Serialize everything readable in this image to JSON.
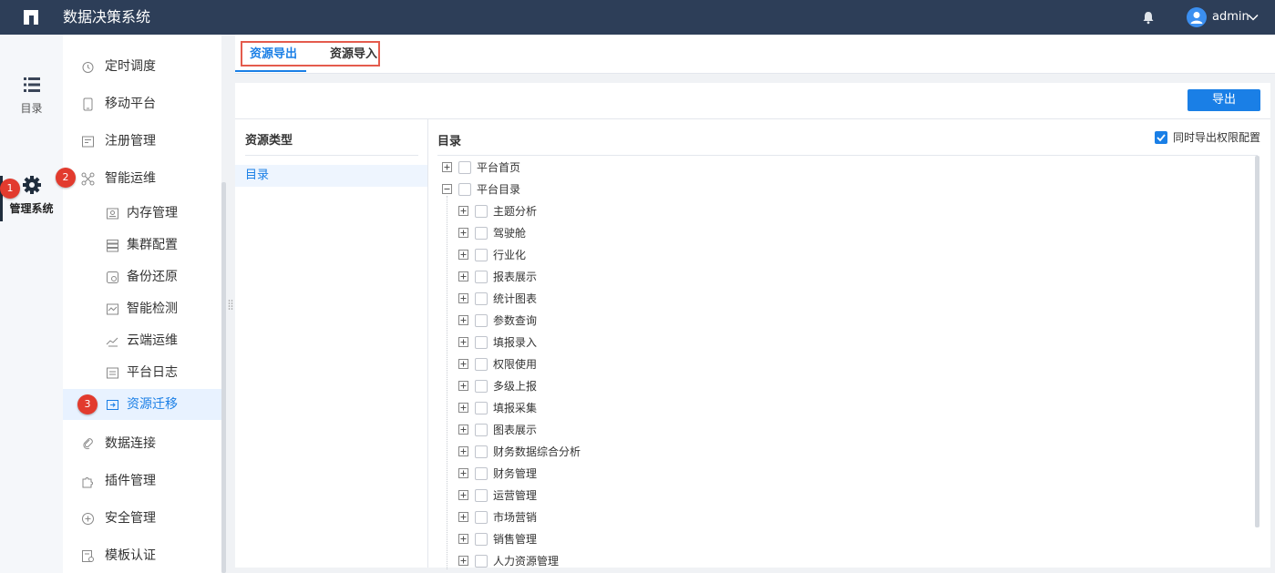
{
  "app": {
    "title": "数据决策系统"
  },
  "user": {
    "name": "admin"
  },
  "rail": [
    {
      "label": "目录",
      "icon": "list-icon"
    },
    {
      "label": "管理系统",
      "icon": "gear-icon"
    }
  ],
  "menu": {
    "items": [
      {
        "label": "定时调度",
        "icon": "timer-icon"
      },
      {
        "label": "移动平台",
        "icon": "mobile-icon"
      },
      {
        "label": "注册管理",
        "icon": "register-icon"
      },
      {
        "label": "智能运维",
        "icon": "ops-icon"
      },
      {
        "label": "内存管理",
        "icon": "memory-icon"
      },
      {
        "label": "集群配置",
        "icon": "cluster-icon"
      },
      {
        "label": "备份还原",
        "icon": "backup-icon"
      },
      {
        "label": "智能检测",
        "icon": "monitor-icon"
      },
      {
        "label": "云端运维",
        "icon": "cloud-ops-icon"
      },
      {
        "label": "平台日志",
        "icon": "log-icon"
      },
      {
        "label": "资源迁移",
        "icon": "migrate-icon"
      },
      {
        "label": "数据连接",
        "icon": "link-icon"
      },
      {
        "label": "插件管理",
        "icon": "plugin-icon"
      },
      {
        "label": "安全管理",
        "icon": "shield-icon"
      },
      {
        "label": "模板认证",
        "icon": "template-auth-icon"
      }
    ]
  },
  "badges": [
    "1",
    "2",
    "3"
  ],
  "tabs": [
    {
      "label": "资源导出"
    },
    {
      "label": "资源导入"
    }
  ],
  "toolbar": {
    "export_label": "导出"
  },
  "resource_type": {
    "header": "资源类型",
    "items": [
      "目录"
    ]
  },
  "directory": {
    "header": "目录",
    "perm_label": "同时导出权限配置",
    "perm_checked": true,
    "nodes": [
      {
        "label": "平台首页",
        "expanded": false
      },
      {
        "label": "平台目录",
        "expanded": true
      }
    ],
    "children": [
      "主题分析",
      "驾驶舱",
      "行业化",
      "报表展示",
      "统计图表",
      "参数查询",
      "填报录入",
      "权限使用",
      "多级上报",
      "填报采集",
      "图表展示",
      "财务数据综合分析",
      "财务管理",
      "运营管理",
      "市场营销",
      "销售管理",
      "人力资源管理"
    ]
  },
  "colors": {
    "topbar": "#2d3e58",
    "accent": "#1a7fe6",
    "badge": "#e23b2e"
  }
}
